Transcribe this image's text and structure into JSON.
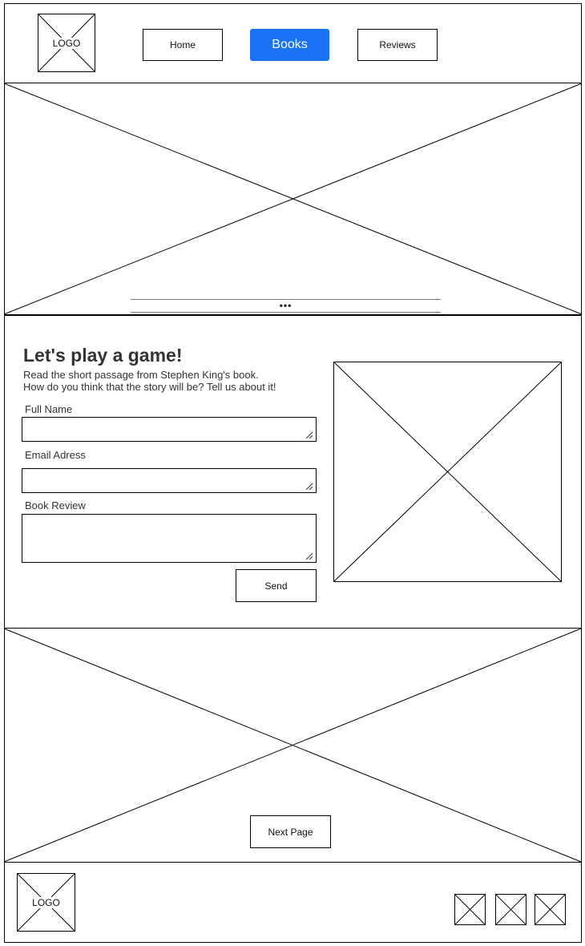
{
  "colors": {
    "accent": "#1a73f5"
  },
  "header": {
    "logo": "LOGO",
    "nav": [
      {
        "label": "Home",
        "active": false
      },
      {
        "label": "Books",
        "active": true
      },
      {
        "label": "Reviews",
        "active": false
      }
    ]
  },
  "hero": {
    "carousel_indicator": "•••"
  },
  "game": {
    "title": "Let's play a game!",
    "intro_line1": "Read the short passage from Stephen King's book.",
    "intro_line2": "How do you think that the story will be? Tell us about it!",
    "fields": [
      {
        "label": "Full Name",
        "value": ""
      },
      {
        "label": "Email Adress",
        "value": ""
      },
      {
        "label": "Book Review",
        "value": ""
      }
    ],
    "send_label": "Send"
  },
  "banner": {
    "next_label": "Next Page"
  },
  "footer": {
    "logo": "LOGO"
  }
}
